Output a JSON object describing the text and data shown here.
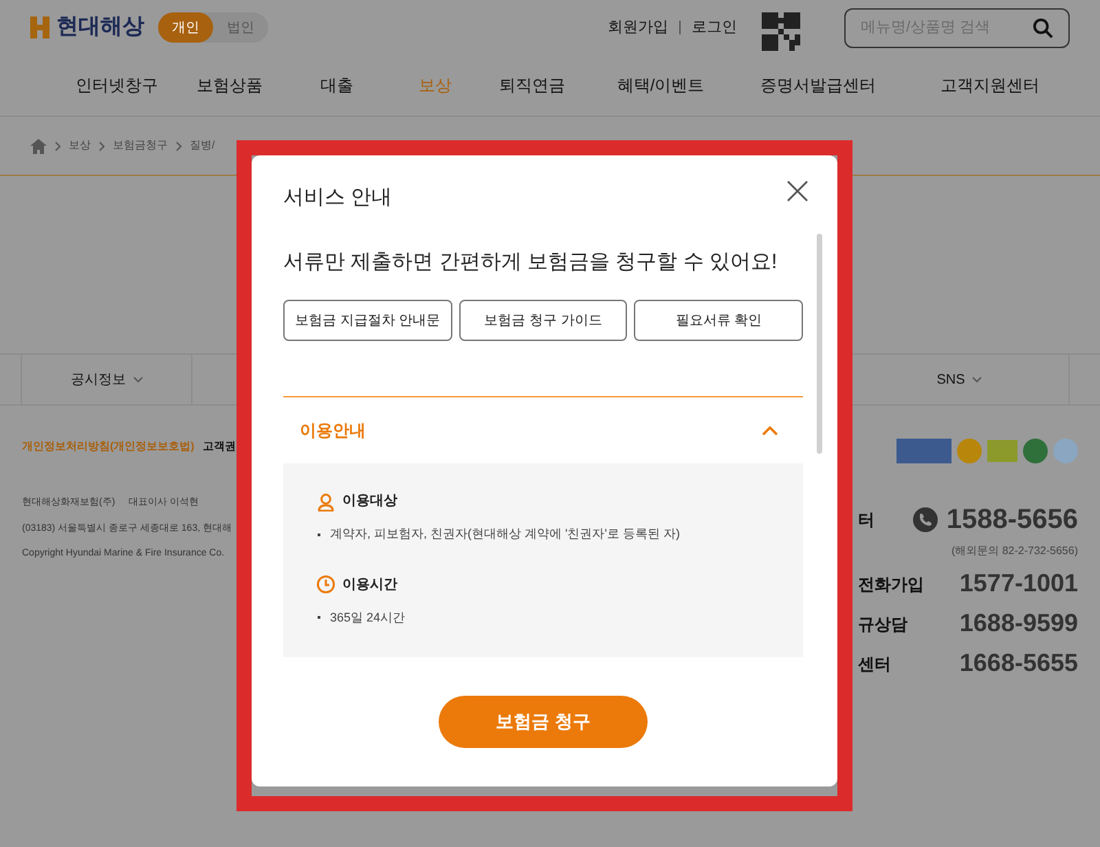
{
  "header": {
    "logo": "현대해상",
    "mode_tabs": [
      {
        "label": "개인",
        "selected": true
      },
      {
        "label": "법인",
        "selected": false
      }
    ],
    "links": [
      "회원가입",
      "로그인"
    ],
    "search": {
      "placeholder": "메뉴명/상품명 검색"
    }
  },
  "nav": [
    {
      "label": "인터넷창구",
      "selected": false
    },
    {
      "label": "보험상품",
      "selected": false
    },
    {
      "label": "대출",
      "selected": false
    },
    {
      "label": "보상",
      "selected": true
    },
    {
      "label": "퇴직연금",
      "selected": false
    },
    {
      "label": "혜택/이벤트",
      "selected": false
    },
    {
      "label": "증명서발급센터",
      "selected": false
    },
    {
      "label": "고객지원센터",
      "selected": false
    }
  ],
  "breadcrumb": [
    "보상",
    "보험금청구",
    "질병/"
  ],
  "footer": {
    "menus": [
      "공시정보",
      "SNS"
    ],
    "policy_links": [
      "개인정보처리방침(개인정보보호법)",
      "고객권"
    ],
    "company_lines": [
      [
        "현대해상화재보험(주)",
        "대표이사 이석현"
      ],
      [
        "(03183) 서울특별시 종로구 세종대로 163, 현대해"
      ],
      [
        "Copyright Hyundai Marine & Fire Insurance Co."
      ]
    ],
    "main_phone": {
      "label": "터",
      "number": "1588-5656",
      "note": "(해외문의 82-2-732-5656)"
    },
    "phones": [
      {
        "label": "전화가입",
        "number": "1577-1001"
      },
      {
        "label": "규상담",
        "number": "1688-9599"
      },
      {
        "label": "센터",
        "number": "1668-5655"
      }
    ]
  },
  "modal": {
    "title": "서비스 안내",
    "headline": "서류만 제출하면 간편하게 보험금을 청구할 수 있어요!",
    "buttons": [
      "보험금 지급절차 안내문",
      "보험금 청구 가이드",
      "필요서류 확인"
    ],
    "section": {
      "title": "이용안내",
      "expanded": true,
      "items": [
        {
          "kind": "person",
          "heading": "이용대상",
          "bullets": [
            "계약자, 피보험자, 친권자(현대해상 계약에 '친권자'로 등록된 자)"
          ]
        },
        {
          "kind": "clock",
          "heading": "이용시간",
          "bullets": [
            "365일 24시간"
          ]
        }
      ]
    },
    "primary_button": "보험금 청구"
  }
}
